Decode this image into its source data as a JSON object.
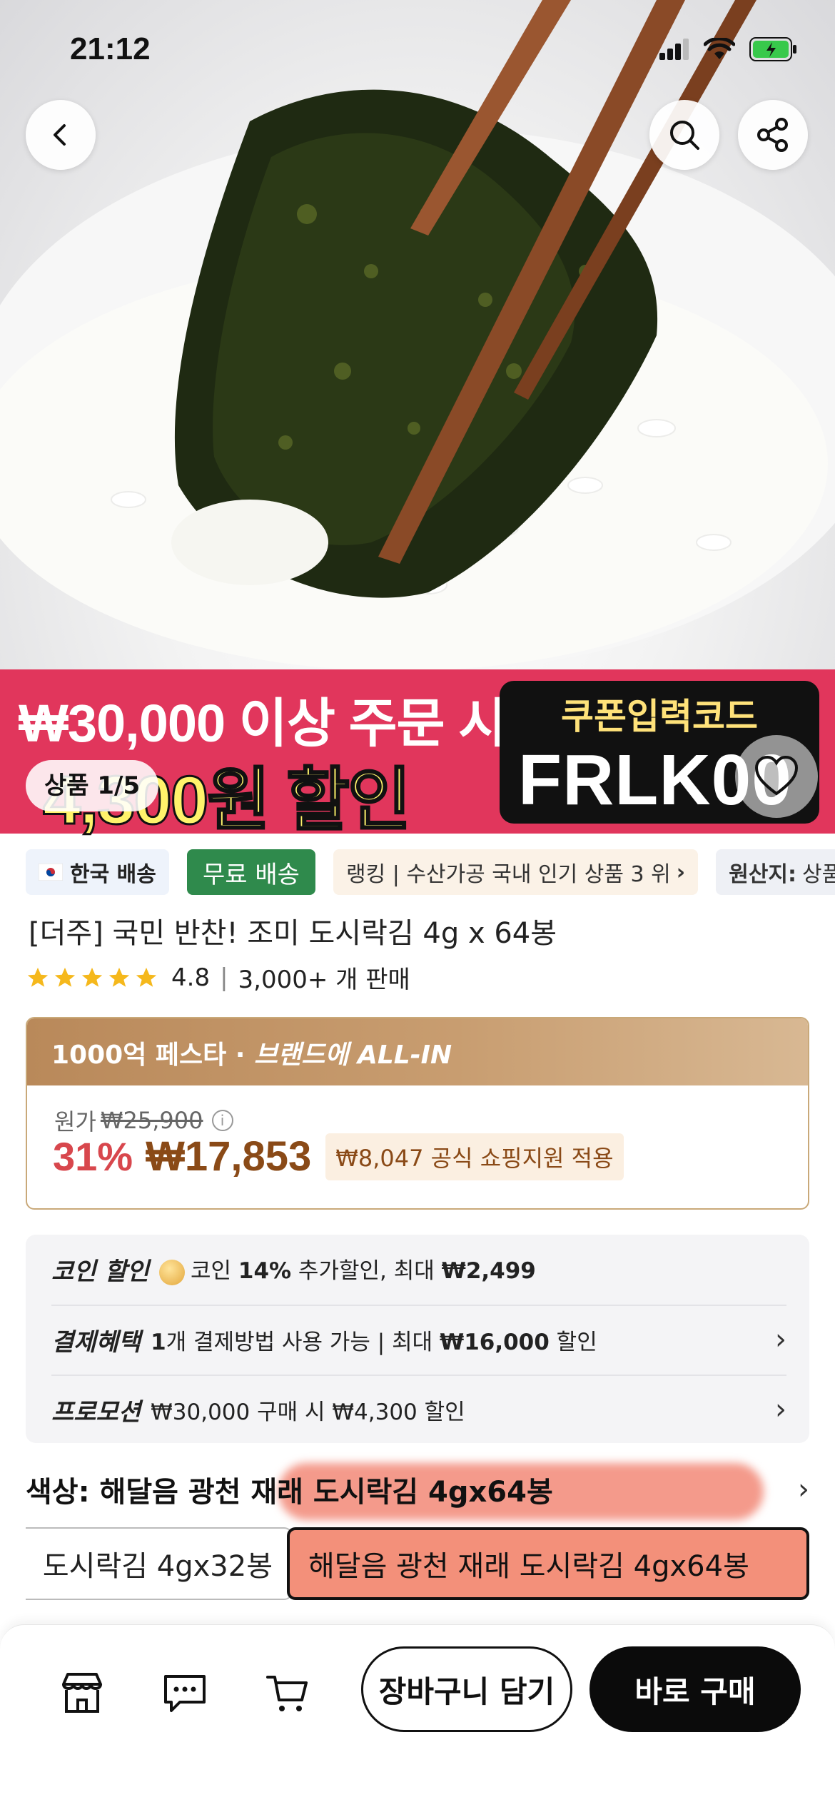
{
  "status_bar": {
    "time": "21:12"
  },
  "hero": {
    "counter": "상품 1/5"
  },
  "banner": {
    "line1": "₩30,000 이상 주문 시",
    "line2": "4,300원 할인",
    "coupon_title": "쿠폰입력코드",
    "coupon_code": "FRLK00"
  },
  "chips": {
    "korea": "한국 배송",
    "free_shipping": "무료 배송",
    "ranking": "랭킹 | 수산가공 국내 인기 상품 3 위",
    "origin_label": "원산지:",
    "origin_value": "상품 상"
  },
  "product": {
    "title": "[더주] 국민 반찬! 조미 도시락김 4g x 64봉",
    "rating": "4.8",
    "sold": "3,000+ 개 판매"
  },
  "price": {
    "head_prefix": "1000억 페스타 · ",
    "head_brand": "브랜드에 ALL-IN",
    "orig_label": "원가",
    "orig_value": "₩25,900",
    "discount": "31%",
    "sale": "₩17,853",
    "support": "₩8,047 공식 쇼핑지원 적용"
  },
  "benefits": {
    "coin_label": "코인 할인",
    "coin_text_a": "코인 ",
    "coin_text_b": "14%",
    "coin_text_c": " 추가할인, 최대 ",
    "coin_text_d": "₩2,499",
    "pay_label": "결제혜택",
    "pay_text_a": "1",
    "pay_text_b": "개 결제방법 사용 가능 | 최대 ",
    "pay_text_c": "₩16,000",
    "pay_text_d": " 할인",
    "promo_label": "프로모션",
    "promo_text": "₩30,000 구매 시 ₩4,300 할인"
  },
  "options": {
    "label": "색상: 해달음 광천 재래 도시락김 4gx64봉",
    "prev": "도시락김 4gx32봉",
    "selected": "해달음 광천 재래 도시락김 4gx64봉"
  },
  "bottom": {
    "cart": "장바구니 담기",
    "buy": "바로 구매"
  },
  "colors": {
    "banner_bg": "#e1365c",
    "free_chip": "#2f8a4c",
    "discount": "#d8474d",
    "sale_price": "#8a4a17",
    "rating_star": "#f5b81c"
  }
}
